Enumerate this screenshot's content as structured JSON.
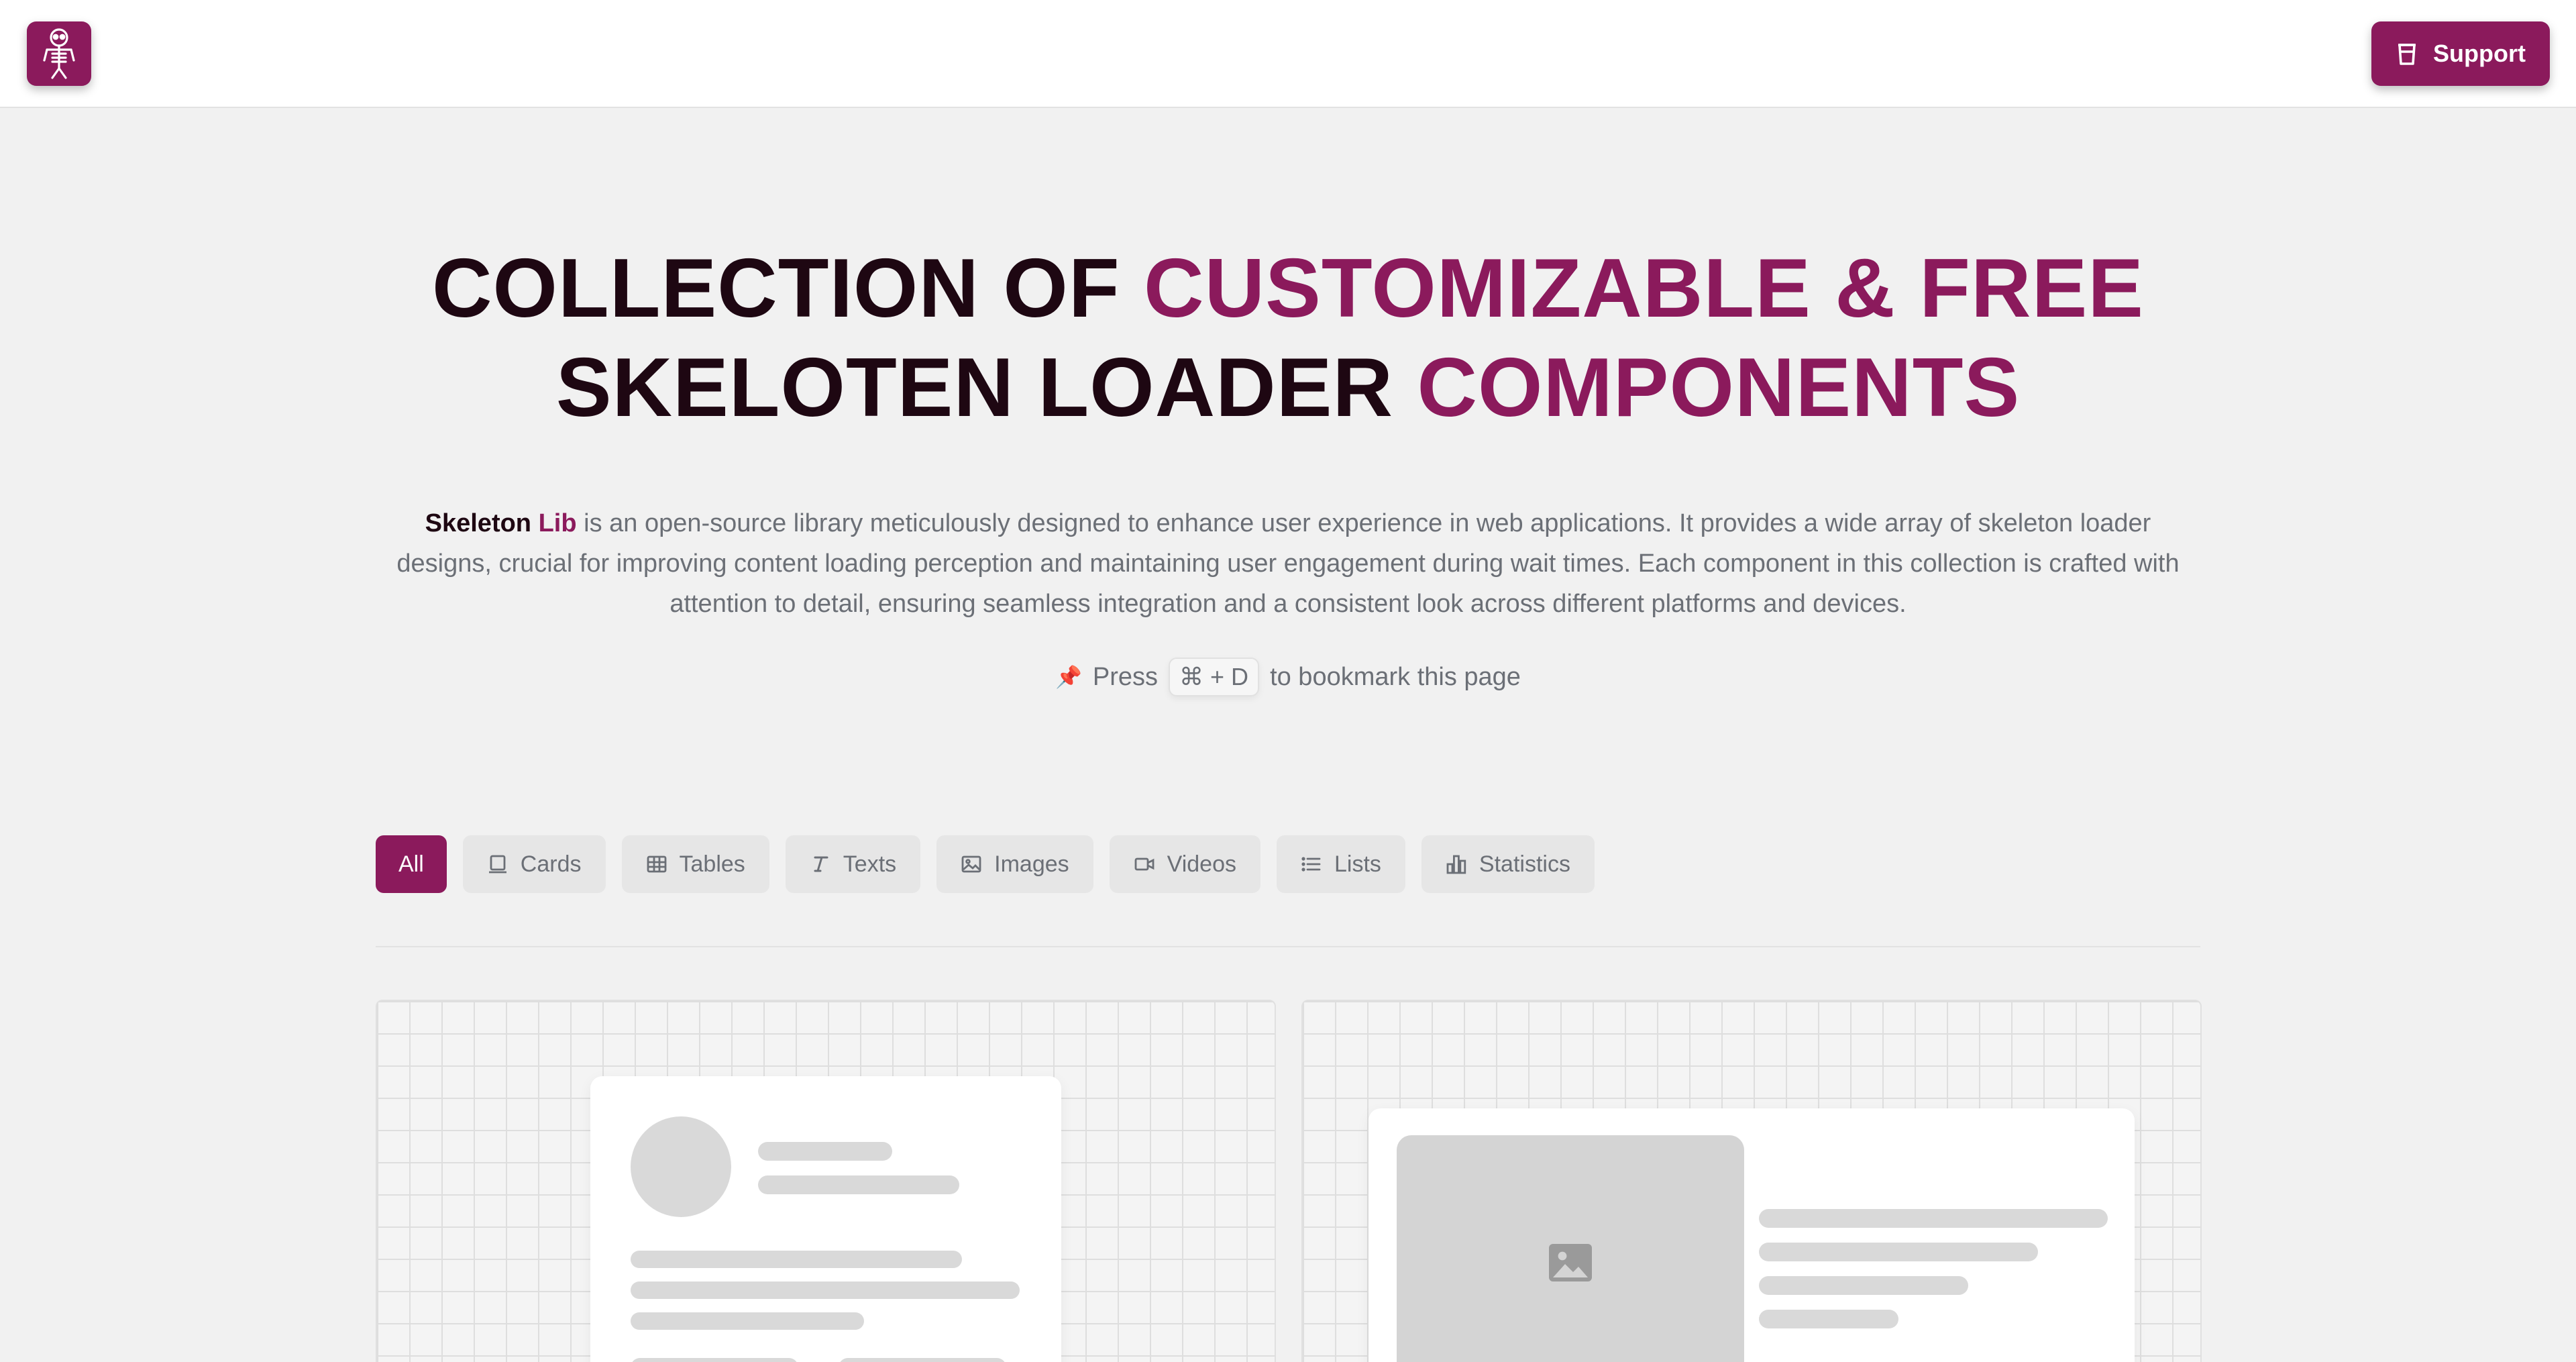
{
  "header": {
    "logo_icon": "skeleton-icon",
    "support_label": "Support",
    "support_icon": "coffee-cup-icon"
  },
  "hero": {
    "title_line1_part1": "COLLECTION",
    "title_line1_part2": " OF ",
    "title_line1_part3": "CUSTOMIZABLE & FREE",
    "title_line2_part1": "SKELOTEN ",
    "title_line2_part2": "LOADER",
    "title_line2_part3": " COMPONENTS",
    "brand_part1": "Skeleton",
    "brand_part2": " Lib",
    "description": " is an open-source library meticulously designed to enhance user experience in web applications. It provides a wide array of skeleton loader designs, crucial for improving content loading perception and maintaining user engagement during wait times. Each component in this collection is crafted with attention to detail, ensuring seamless integration and a consistent look across different platforms and devices.",
    "bookmark_pin": "📌",
    "bookmark_press": "Press",
    "bookmark_keys": "⌘ + D",
    "bookmark_suffix": "to bookmark this page"
  },
  "filters": {
    "items": [
      {
        "label": "All",
        "icon": "",
        "active": true
      },
      {
        "label": "Cards",
        "icon": "card-icon"
      },
      {
        "label": "Tables",
        "icon": "table-icon"
      },
      {
        "label": "Texts",
        "icon": "text-icon"
      },
      {
        "label": "Images",
        "icon": "image-icon"
      },
      {
        "label": "Videos",
        "icon": "video-icon"
      },
      {
        "label": "Lists",
        "icon": "list-icon"
      },
      {
        "label": "Statistics",
        "icon": "bar-chart-icon"
      }
    ]
  },
  "colors": {
    "accent": "#8b1a5c",
    "dark": "#1e0712",
    "muted_text": "#6b6f76",
    "background": "#f1f1f1",
    "skeleton": "#d9d9d9"
  }
}
